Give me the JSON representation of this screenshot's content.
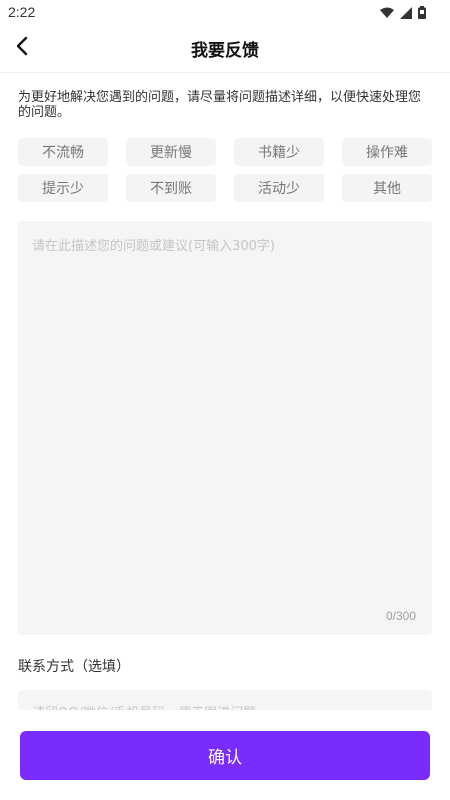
{
  "status_bar": {
    "time": "2:22",
    "icons": [
      "wifi-icon",
      "signal-icon",
      "battery-icon"
    ]
  },
  "header": {
    "title": "我要反馈",
    "back_icon": "chevron-left-icon"
  },
  "intro_text": "为更好地解决您遇到的问题，请尽量将问题描述详细，以便快速处理您的问题。",
  "tags": [
    {
      "label": "不流畅"
    },
    {
      "label": "更新慢"
    },
    {
      "label": "书籍少"
    },
    {
      "label": "操作难"
    },
    {
      "label": "提示少"
    },
    {
      "label": "不到账"
    },
    {
      "label": "活动少"
    },
    {
      "label": "其他"
    }
  ],
  "description": {
    "placeholder": "请在此描述您的问题或建议(可输入300字)",
    "value": "",
    "counter": "0/300"
  },
  "contact": {
    "label": "联系方式（选填）",
    "placeholder": "请留QQ/微信/手机号码，便于跟进问题",
    "value": ""
  },
  "confirm_label": "确认",
  "colors": {
    "accent": "#7a2cff",
    "tag_bg": "#f4f4f4",
    "input_bg": "#f5f5f5"
  }
}
